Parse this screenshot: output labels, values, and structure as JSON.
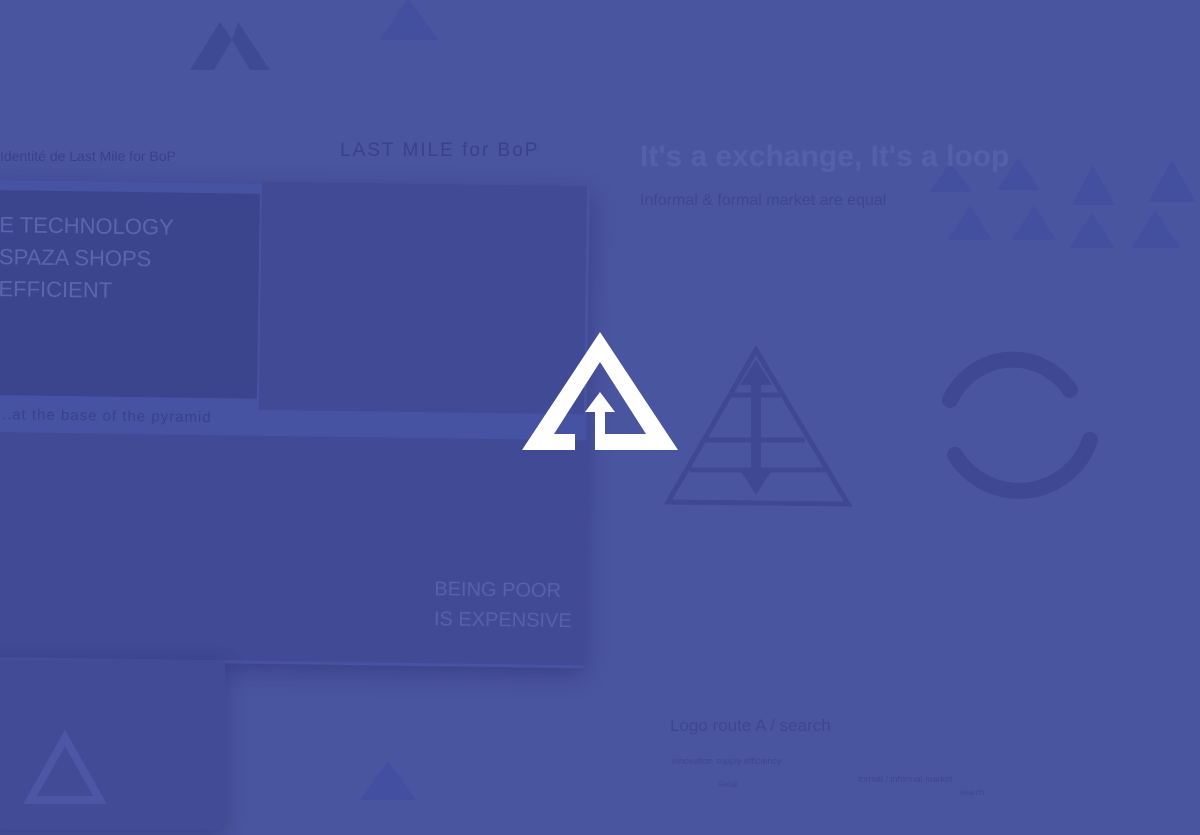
{
  "brand": {
    "background_color": "#4a55a0",
    "faint_color": "#3d4791",
    "logo_color": "#ffffff",
    "logo_icon": "pyramid-arrow-icon"
  },
  "board_left": {
    "caption_left": "Identité de Last Mile for BoP",
    "caption_right": "LAST MILE for BoP",
    "overlay_lines": [
      "E TECHNOLOGY",
      "SPAZA SHOPS",
      "EFFICIENT"
    ],
    "subcaption": "...at the base of the pyramid",
    "photo_caption_lines": [
      "BEING POOR",
      "IS EXPENSIVE"
    ]
  },
  "board_right": {
    "headline": "It's a exchange, It's a loop",
    "subheadline": "Informal & formal market are equal",
    "section_title": "Logo route A / search",
    "note_left": "innovation supply efficiency",
    "note_right": "formal / informal market",
    "note_small": "Retail",
    "note_small_right": "search"
  }
}
